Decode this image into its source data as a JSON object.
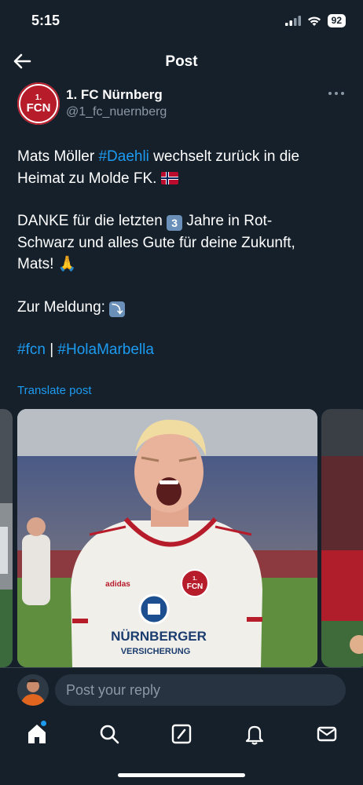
{
  "status_bar": {
    "time": "5:15",
    "battery": "92"
  },
  "header": {
    "title": "Post"
  },
  "post": {
    "author": {
      "avatar_text_top": "1.",
      "avatar_text_main": "FCN",
      "name": "1. FC Nürnberg",
      "handle": "@1_fc_nuernberg"
    },
    "text": {
      "p1_a": "Mats Möller ",
      "p1_hashtag": "#Daehli",
      "p1_b": " wechselt zurück in die",
      "p1_line2": "Heimat zu Molde FK. ",
      "p2_a": "DANKE für die letzten ",
      "p2_keycap": "3",
      "p2_b": " Jahre in Rot-",
      "p2_line2": "Schwarz und alles Gute für deine Zukunft,",
      "p2_line3": "Mats! 🙏",
      "p3": "Zur Meldung: ",
      "p3_icon": "⤵",
      "p4_tag1": "#fcn",
      "p4_sep": " | ",
      "p4_tag2": "#HolaMarbella"
    },
    "translate_label": "Translate post",
    "media": {
      "shirt_brand": "adidas",
      "sponsor_line1": "NÜRNBERGER",
      "sponsor_line2": "VERSICHERUNG",
      "badge_top": "1.",
      "badge_main": "FCN"
    }
  },
  "reply": {
    "placeholder": "Post your reply"
  },
  "tabs": [
    "home-icon",
    "search-icon",
    "grok-icon",
    "bell-icon",
    "mail-icon"
  ],
  "colors": {
    "background": "#15202b",
    "accent": "#1d9bf0",
    "muted": "#8b98a5",
    "club_red": "#b71c2b"
  }
}
